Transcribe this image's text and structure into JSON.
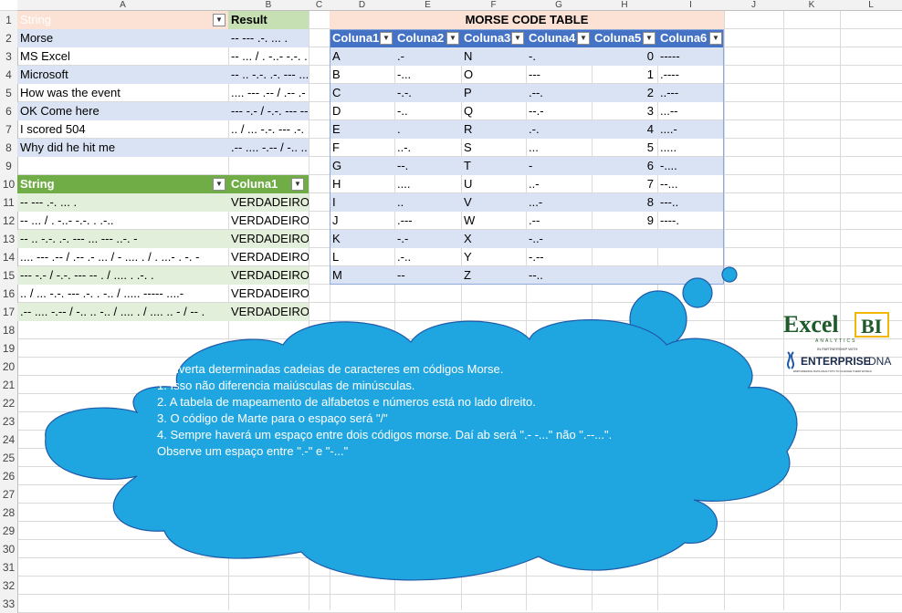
{
  "columns": [
    "A",
    "B",
    "C",
    "D",
    "E",
    "F",
    "G",
    "H",
    "I",
    "J",
    "K",
    "L"
  ],
  "rows": [
    "1",
    "2",
    "3",
    "4",
    "5",
    "6",
    "7",
    "8",
    "9",
    "10",
    "11",
    "12",
    "13",
    "14",
    "15",
    "16",
    "17",
    "18",
    "19",
    "20",
    "21",
    "22",
    "23",
    "24",
    "25",
    "26",
    "27",
    "28",
    "29",
    "30",
    "31",
    "32",
    "33"
  ],
  "table1": {
    "header_string": "String",
    "header_result": "Result",
    "strings": [
      "Morse",
      "MS Excel",
      "Microsoft",
      "How was the event",
      "OK Come here",
      "I scored 504",
      "Why did he hit me"
    ],
    "results": [
      "-- --- .-. ... .",
      "-- ... / . -..- -.-. . .-..",
      "-- .. -.-. .-. --- ... --- ..-. -",
      "....  --- .-- / .-- .- ... / - .... . / . ...- . -. -",
      "--- -.- / -.-. --- -- . / .... . .-. .",
      ".. / ... -.-. --- .-. . -.. / ..... ----- ....-",
      ".-- .... -.-- / -.. .. -.. / .... . / .... .. - / -- ."
    ]
  },
  "table2": {
    "header_string": "String",
    "header_col": "Coluna1",
    "strings": [
      "-- --- .-. ... .",
      "-- ... / . -..- -.-. . .-..",
      "-- .. -.-. .-. --- ... --- ..-. -",
      ".... --- .-- / .-- .- ... / - .... . / . ...- . -. -",
      "--- -.- / -.-. --- -- . / .... . .-. .",
      ".. / ... -.-. --- .-. . -.. / ..... ----- ....-",
      ".-- .... -.-- / -.. .. -.. / .... . / .... .. - / -- ."
    ],
    "values": [
      "VERDADEIRO",
      "VERDADEIRO",
      "VERDADEIRO",
      "VERDADEIRO",
      "VERDADEIRO",
      "VERDADEIRO",
      "VERDADEIRO"
    ]
  },
  "morse_table": {
    "title": "MORSE CODE TABLE",
    "headers": [
      "Coluna1",
      "Coluna2",
      "Coluna3",
      "Coluna4",
      "Coluna5",
      "Coluna6"
    ],
    "rows": [
      [
        "A",
        ".-",
        "N",
        "-.",
        "0",
        "-----"
      ],
      [
        "B",
        "-...",
        "O",
        "---",
        "1",
        ".----"
      ],
      [
        "C",
        "-.-.",
        "P",
        ".--.",
        "2",
        "..---"
      ],
      [
        "D",
        "-..",
        "Q",
        "--.-",
        "3",
        "...--"
      ],
      [
        "E",
        ".",
        "R",
        ".-.",
        "4",
        "....-"
      ],
      [
        "F",
        "..-.",
        "S",
        "...",
        "5",
        "....."
      ],
      [
        "G",
        "--.",
        "T",
        "-",
        "6",
        "-...."
      ],
      [
        "H",
        "....",
        "U",
        "..-",
        "7",
        "--..."
      ],
      [
        "I",
        "..",
        "V",
        "...-",
        "8",
        "---.."
      ],
      [
        "J",
        ".---",
        "W",
        ".--",
        "9",
        "----."
      ],
      [
        "K",
        "-.-",
        "X",
        "-..-",
        "",
        ""
      ],
      [
        "L",
        ".-..",
        "Y",
        "-.--",
        "",
        ""
      ],
      [
        "M",
        "--",
        "Z",
        "--..",
        "",
        ""
      ]
    ]
  },
  "callout": {
    "lines": [
      "Converta determinadas cadeias de caracteres em códigos Morse.",
      "1. Isso não diferencia maiúsculas de minúsculas.",
      "2. A tabela de mapeamento de alfabetos e números está no lado direito.",
      "3. O código de Marte para o espaço será \"/\"",
      "4. Sempre haverá um espaço entre dois códigos morse. Daí ab será \".- -...\" não \".--...\".",
      "Observe um espaço entre \".-\" e \"-...\""
    ]
  },
  "logo": {
    "excel": "Excel",
    "bi": "BI",
    "analytics": "ANALYTICS",
    "partnership": "IN PARTNERSHIP WITH",
    "enterprise": "ENTERPRISE",
    "dna": "DNA",
    "tagline": "EMPOWERING DATA ANALYSTS TO CHANGE THEIR WORLD"
  },
  "colors": {
    "cloud_fill": "#1fa6e0",
    "cloud_stroke": "#1f5aa8",
    "table_header": "#4472c4",
    "banded_row": "#dae3f3",
    "green_header": "#70ad47"
  }
}
